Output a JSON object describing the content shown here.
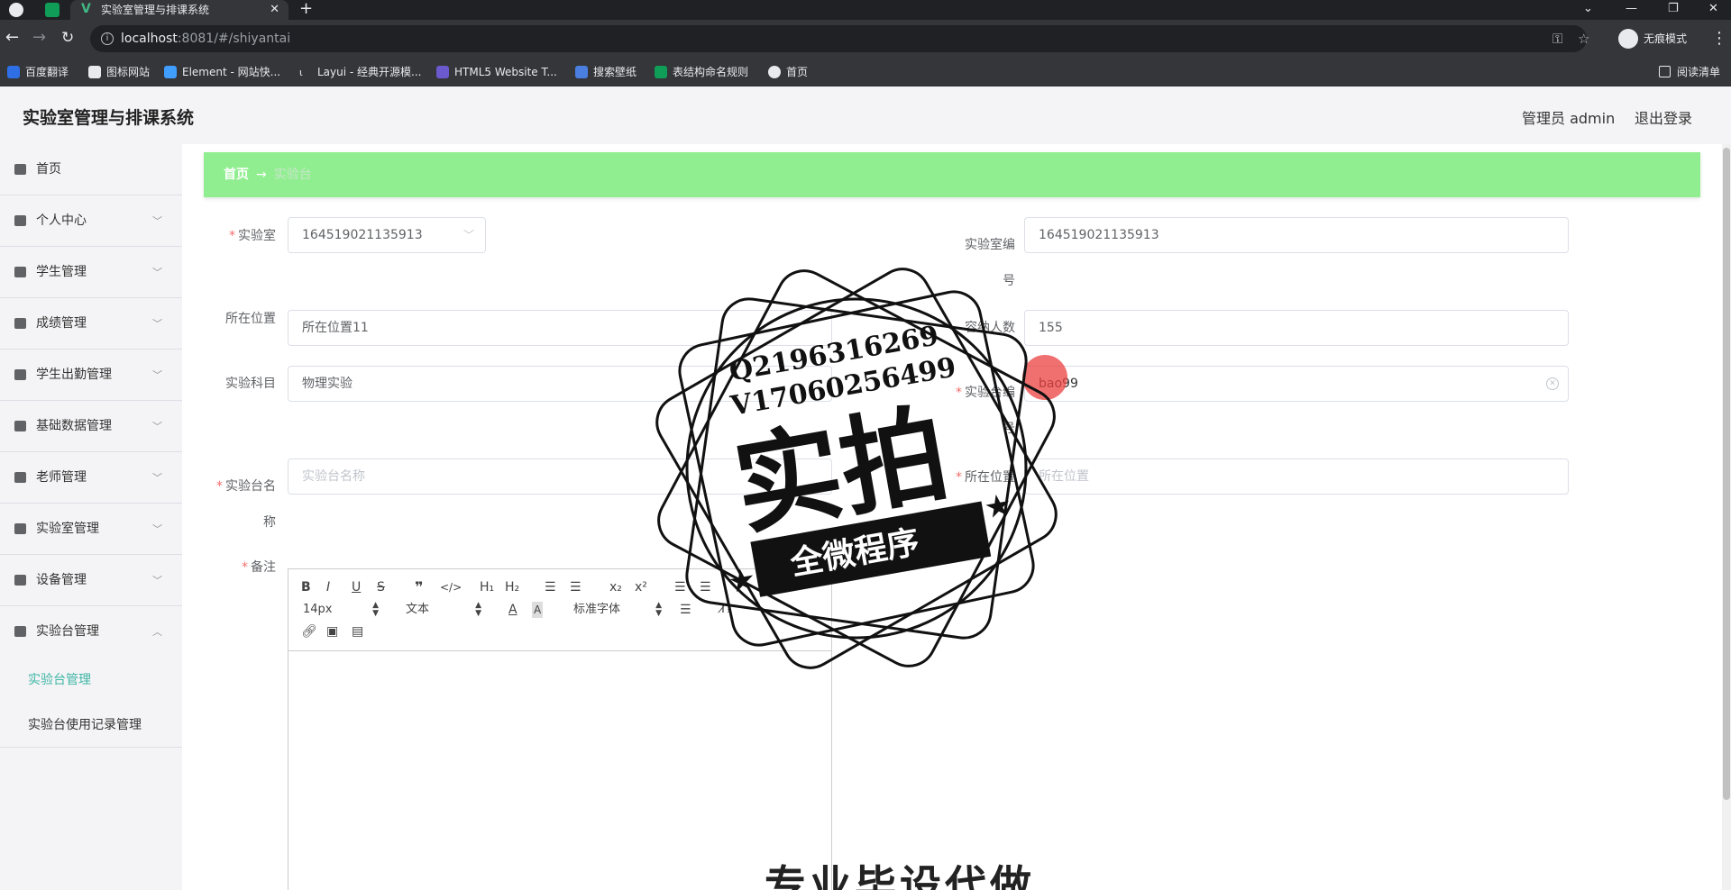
{
  "browser": {
    "tab_title": "实验室管理与排课系统",
    "url_host": "localhost",
    "url_path": ":8081/#/shiyantai",
    "profile_mode": "无痕模式",
    "bookmarks": [
      "百度翻译",
      "图标网站",
      "Element - 网站快...",
      "Layui - 经典开源模...",
      "HTML5 Website T...",
      "搜索壁纸",
      "表结构命名规则",
      "首页"
    ],
    "reading_list": "阅读清单"
  },
  "header": {
    "title": "实验室管理与排课系统",
    "admin": "管理员 admin",
    "logout": "退出登录"
  },
  "sidebar": {
    "items": [
      {
        "label": "首页",
        "icon": "home-icon"
      },
      {
        "label": "个人中心",
        "icon": "user-icon"
      },
      {
        "label": "学生管理",
        "icon": "student-icon"
      },
      {
        "label": "成绩管理",
        "icon": "score-icon"
      },
      {
        "label": "学生出勤管理",
        "icon": "attendance-icon"
      },
      {
        "label": "基础数据管理",
        "icon": "data-icon"
      },
      {
        "label": "老师管理",
        "icon": "teacher-icon"
      },
      {
        "label": "实验室管理",
        "icon": "lab-icon"
      },
      {
        "label": "设备管理",
        "icon": "device-icon"
      },
      {
        "label": "实验台管理",
        "icon": "bench-icon"
      }
    ],
    "sub_items": [
      "实验台管理",
      "实验台使用记录管理"
    ]
  },
  "breadcrumb": {
    "home": "首页",
    "arrow": "→",
    "current": "实验台"
  },
  "form": {
    "lab_label": "实验室",
    "lab_value": "164519021135913",
    "lab_no_label": "实验室编号",
    "lab_no_value": "164519021135913",
    "location_label": "所在位置",
    "location_value": "所在位置11",
    "capacity_label": "容纳人数",
    "capacity_value": "155",
    "subject_label": "实验科目",
    "subject_value": "物理实验",
    "bench_no_label": "实验台编号",
    "bench_no_value": "bao99",
    "bench_name_label": "实验台名称",
    "bench_name_placeholder": "实验台名称",
    "bench_pos_label": "所在位置",
    "bench_pos_placeholder": "所在位置",
    "remark_label": "备注"
  },
  "editor": {
    "font_size": "14px",
    "block_type": "文本",
    "font_family": "标准字体"
  },
  "watermark": {
    "qq": "Q2196316269",
    "wechat": "V17060256499",
    "big": "实拍",
    "banner": "全微程序",
    "bottom": "专业毕设代做"
  }
}
